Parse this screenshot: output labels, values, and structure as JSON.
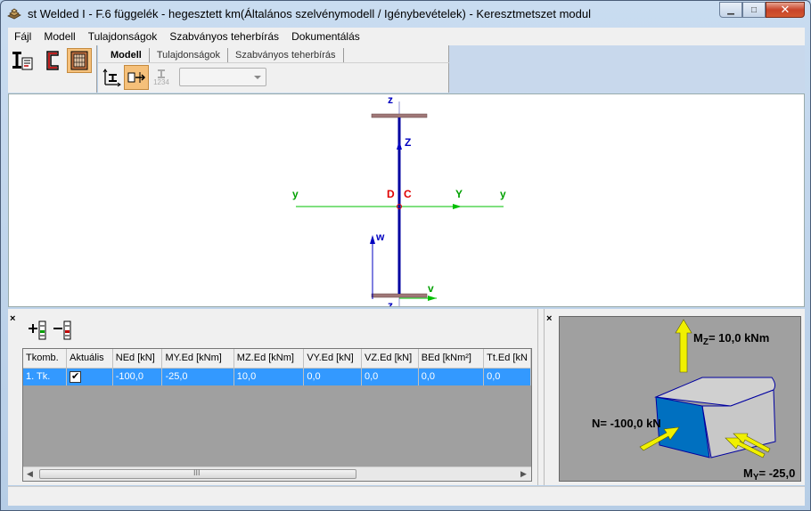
{
  "window": {
    "title": "st Welded I - F.6 függelék - hegesztett km(Általános szelvénymodell / Igénybevételek) - Keresztmetszet modul",
    "minimize_label": "▁",
    "maximize_label": "□",
    "close_label": "✕"
  },
  "menu": {
    "items": [
      "Fájl",
      "Modell",
      "Tulajdonságok",
      "Szabványos teherbírás",
      "Dokumentálás"
    ]
  },
  "toolbar": {
    "tabs": [
      "Modell",
      "Tulajdonságok",
      "Szabványos teherbírás"
    ],
    "selected_tab": "Modell",
    "numbering_icon_text": "1234",
    "dropdown_value": ""
  },
  "canvas": {
    "labels": {
      "z_top": "z",
      "z_axis": "Z",
      "y_left": "y",
      "d_label": "D",
      "c_label": "C",
      "y_axis": "Y",
      "y_right": "y",
      "w_label": "w",
      "v_label": "v",
      "z_bottom": "z"
    },
    "colors": {
      "web": "#0000a0",
      "flange": "#a07878",
      "y_axis": "#00c000",
      "z_axis": "#0000c0",
      "center_labels": "#e00000",
      "web_line": "#9090d0"
    }
  },
  "load_cases": {
    "add_icon": "add-row-icon",
    "remove_icon": "remove-row-icon",
    "columns": [
      "Tkomb.",
      "Aktuális",
      "NEd [kN]",
      "MY.Ed [kNm]",
      "MZ.Ed [kNm]",
      "VY.Ed [kN]",
      "VZ.Ed [kN]",
      "BEd [kNm²]",
      "Tt.Ed [kN"
    ],
    "rows": [
      {
        "name": "1. Tk.",
        "active": true,
        "N": "-100,0",
        "MY": "-25,0",
        "MZ": "10,0",
        "VY": "0,0",
        "VZ": "0,0",
        "B": "0,0",
        "Tt": "0,0"
      }
    ],
    "scroll_grip": "III"
  },
  "load_view": {
    "mz_label": "M",
    "mz_sub": "Z",
    "mz_value": "= 10,0 kNm",
    "n_label": "N= -100,0 kN",
    "my_label": "M",
    "my_sub": "Y",
    "my_value": "= -25,0",
    "colors": {
      "arrow": "#f0f000",
      "block_side": "#0070c0",
      "block_face": "#c8c8c8"
    }
  },
  "close_pane_label": "×"
}
